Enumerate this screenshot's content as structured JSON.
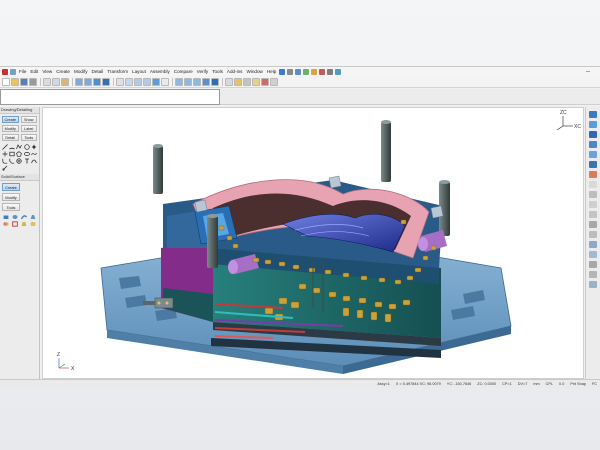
{
  "menu": [
    "File",
    "Edit",
    "View",
    "Create",
    "Modify",
    "Detail",
    "Transform",
    "Layout",
    "Assembly",
    "Compare",
    "Verify",
    "Tools",
    "Add-ins",
    "Window",
    "Help"
  ],
  "left_panel": {
    "drawing_section_title": "Drawing/Detailing",
    "drawing_buttons": [
      "Create",
      "Show",
      "Modify",
      "Label",
      "Detail",
      "Tools"
    ],
    "solid_section_title": "Solid/Surface",
    "solid_buttons": [
      "Create",
      "Modify",
      "Tools"
    ]
  },
  "viewport": {
    "triad_top": {
      "z": "ZC",
      "x": "XC"
    },
    "triad_bottom": {
      "z": "Z",
      "x": "X"
    }
  },
  "status": {
    "prompt": "Assy=1",
    "coords": "X = 0.497844  XC: 96.0079",
    "yc": "YC: -150.7646",
    "zc": "ZC: 0.0000",
    "cplane": "CP=1",
    "dim": "DV=7",
    "mode": "mm",
    "cpl": "CPL",
    "val": "0.0",
    "snap": "Pnt Snap",
    "fc": "FC"
  },
  "colors": {
    "mold_base": "#6e9fc6",
    "mold_plate": "#1f6b6b",
    "cavity_pink": "#e8a3b3",
    "core_blue": "#2f3fa8",
    "fittings": "#c9a23a",
    "pillars": "#4d5b5e",
    "cylinders": "#a66fc5"
  }
}
